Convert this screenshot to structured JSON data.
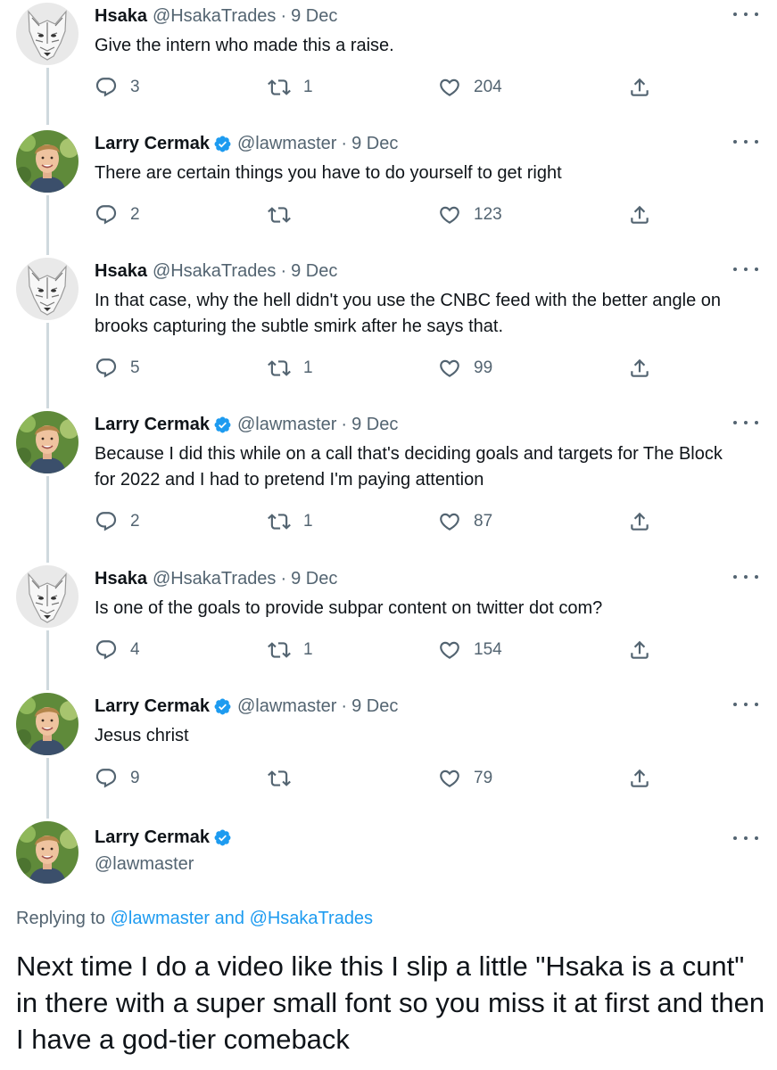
{
  "users": {
    "hsaka": {
      "name": "Hsaka",
      "handle": "@HsakaTrades"
    },
    "larry": {
      "name": "Larry Cermak",
      "handle": "@lawmaster"
    }
  },
  "colors": {
    "accent": "#1d9bf0",
    "text": "#0f1419",
    "muted": "#536471",
    "thread_line": "#cfd9de"
  },
  "icons": {
    "reply": "reply-bubble-icon",
    "retweet": "retweet-arrows-icon",
    "like": "heart-icon",
    "share": "share-upload-icon",
    "more": "more-dots-icon",
    "verified": "verified-badge-icon"
  },
  "replies": [
    {
      "author": "Hsaka",
      "handle": "@HsakaTrades",
      "sep": "·",
      "date": "9 Dec",
      "text": "Give the intern who made this a raise.",
      "replies": "3",
      "retweets": "1",
      "likes": "204"
    },
    {
      "author": "Larry Cermak",
      "handle": "@lawmaster",
      "sep": "·",
      "date": "9 Dec",
      "text": "There are certain things you have to do yourself to get right",
      "replies": "2",
      "retweets": "",
      "likes": "123"
    },
    {
      "author": "Hsaka",
      "handle": "@HsakaTrades",
      "sep": "·",
      "date": "9 Dec",
      "text": "In that case, why the hell didn't you use the CNBC feed with the better angle on brooks capturing the subtle smirk after he says that.",
      "replies": "5",
      "retweets": "1",
      "likes": "99"
    },
    {
      "author": "Larry Cermak",
      "handle": "@lawmaster",
      "sep": "·",
      "date": "9 Dec",
      "text": "Because I did this while on a call that's deciding goals and targets for The Block for 2022 and I had to pretend I'm paying attention",
      "replies": "2",
      "retweets": "1",
      "likes": "87"
    },
    {
      "author": "Hsaka",
      "handle": "@HsakaTrades",
      "sep": "·",
      "date": "9 Dec",
      "text": "Is one of the goals to provide subpar content on twitter dot com?",
      "replies": "4",
      "retweets": "1",
      "likes": "154"
    },
    {
      "author": "Larry Cermak",
      "handle": "@lawmaster",
      "sep": "·",
      "date": "9 Dec",
      "text": "Jesus christ",
      "replies": "9",
      "retweets": "",
      "likes": "79"
    }
  ],
  "main_tweet": {
    "author": "Larry Cermak",
    "handle": "@lawmaster",
    "replying_prefix": "Replying to",
    "replying_user1": "@lawmaster",
    "replying_and": "and",
    "replying_user2": "@HsakaTrades",
    "text": "Next time I do a video like this I slip a little \"Hsaka is a cunt\" in there with a super small font so you miss it at first and then I have a god-tier comeback"
  }
}
